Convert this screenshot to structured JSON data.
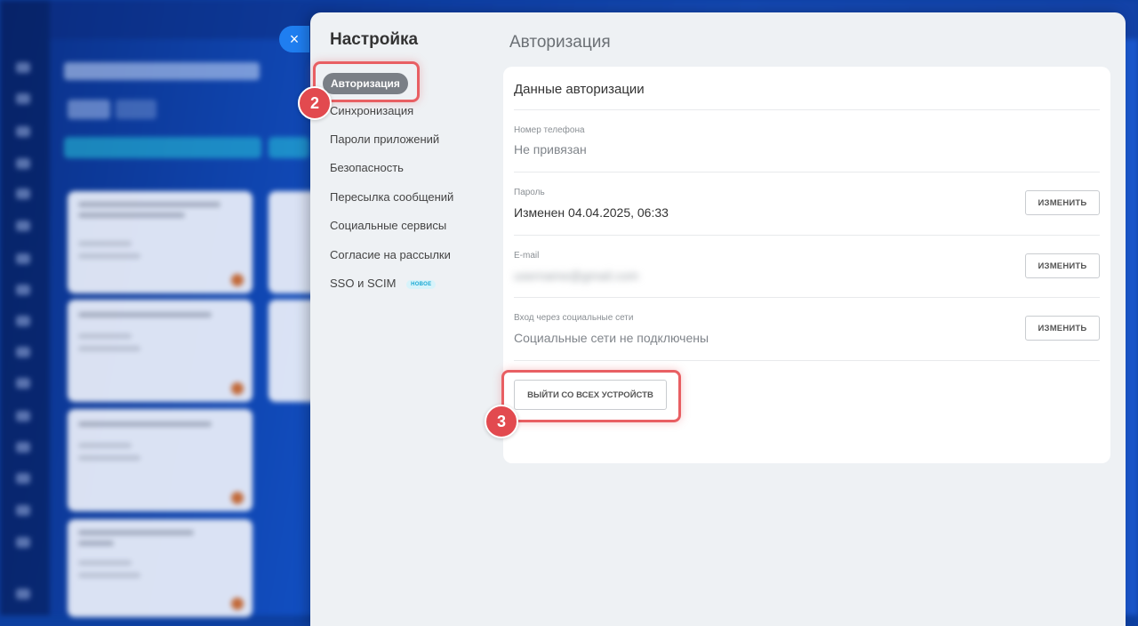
{
  "close_glyph": "×",
  "settings": {
    "title": "Настройка",
    "nav": [
      {
        "label": "Авторизация",
        "active": true
      },
      {
        "label": "Синхронизация"
      },
      {
        "label": "Пароли приложений"
      },
      {
        "label": "Безопасность"
      },
      {
        "label": "Пересылка сообщений"
      },
      {
        "label": "Социальные сервисы"
      },
      {
        "label": "Согласие на рассылки"
      },
      {
        "label": "SSO и SCIM",
        "badge": "НОВОЕ"
      }
    ]
  },
  "auth": {
    "section_title": "Авторизация",
    "card_title": "Данные авторизации",
    "fields": [
      {
        "label": "Номер телефона",
        "value": "Не привязан"
      },
      {
        "label": "Пароль",
        "value": "Изменен 04.04.2025, 06:33",
        "button": "ИЗМЕНИТЬ"
      },
      {
        "label": "E-mail",
        "value": "username@gmail.com",
        "button": "ИЗМЕНИТЬ"
      },
      {
        "label": "Вход через социальные сети",
        "value": "Социальные сети не подключены",
        "button": "ИЗМЕНИТЬ"
      }
    ],
    "logout_all_label": "ВЫЙТИ СО ВСЕХ УСТРОЙСТВ"
  },
  "steps": {
    "nav": "2",
    "logout": "3"
  },
  "colors": {
    "highlight": "#e85f63",
    "step_badge": "#e24a4f",
    "active_nav": "#7a7f86",
    "close_button": "#1f7ef0"
  }
}
